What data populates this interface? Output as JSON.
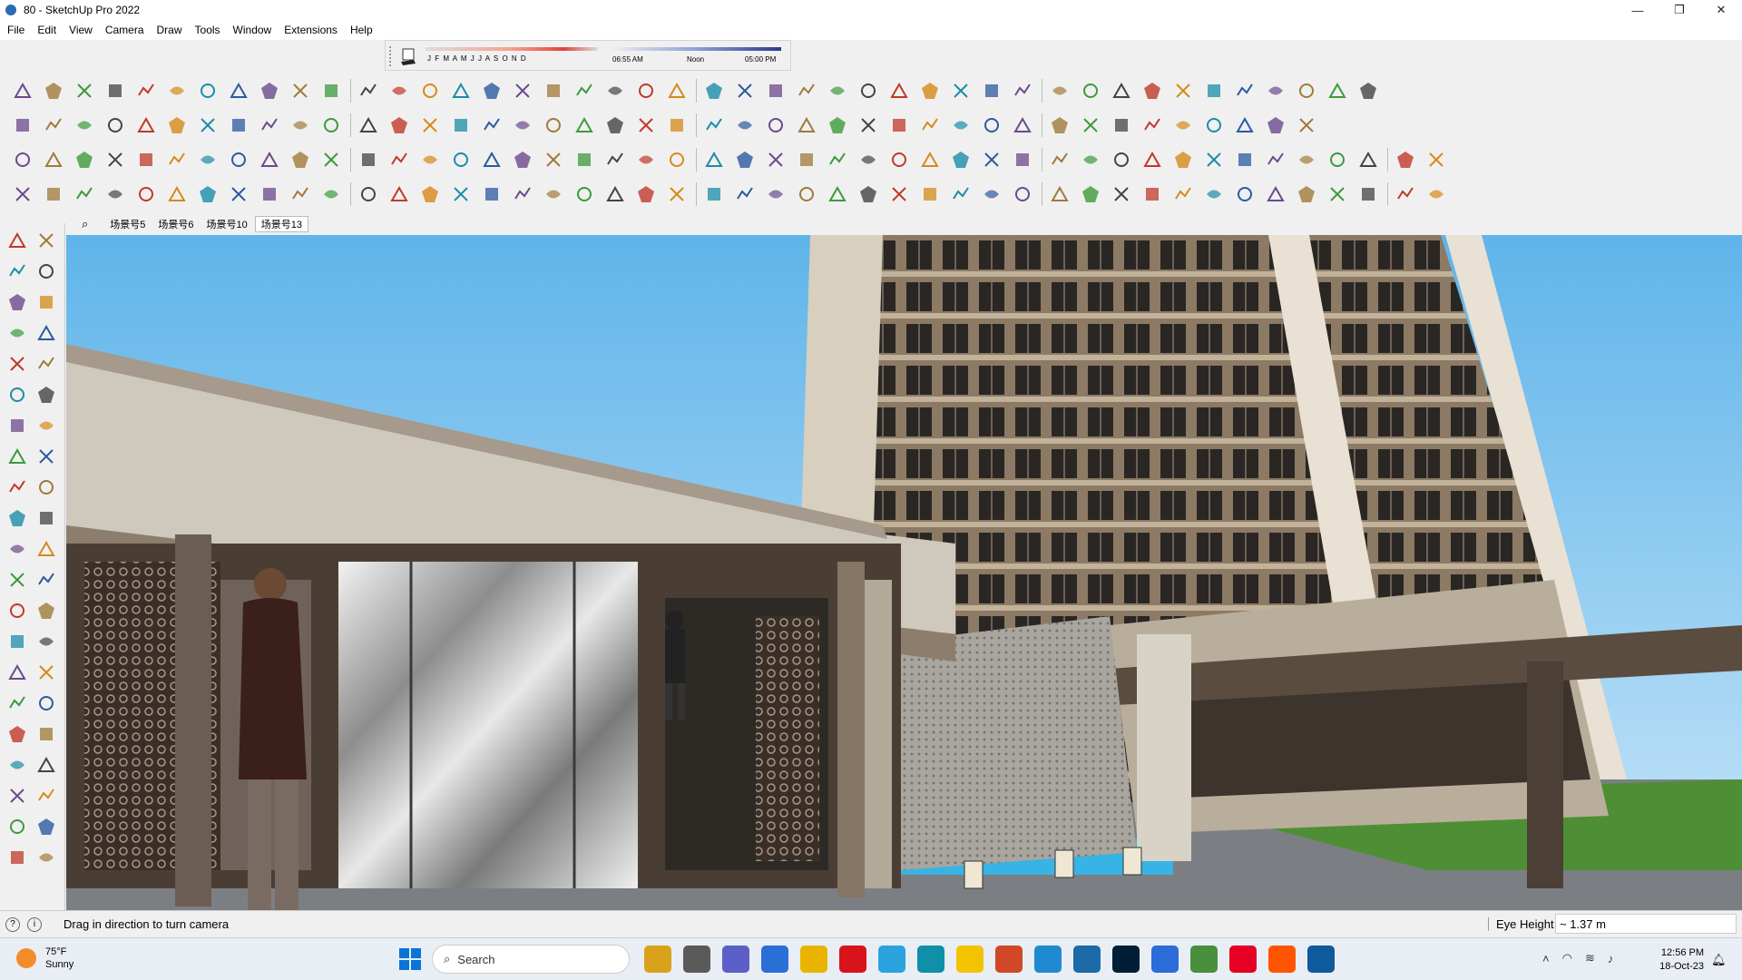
{
  "window": {
    "title": "80 - SketchUp Pro 2022",
    "minimize": "—",
    "maximize": "❐",
    "close": "✕"
  },
  "menu": [
    "File",
    "Edit",
    "View",
    "Camera",
    "Draw",
    "Tools",
    "Window",
    "Extensions",
    "Help"
  ],
  "shadows": {
    "months": "J F M A M J J A S O N D",
    "time_start": "06:55 AM",
    "time_mid": "Noon",
    "time_end": "05:00 PM"
  },
  "scenes": {
    "tabs": [
      "场景号5",
      "场景号6",
      "场景号10",
      "场景号13"
    ],
    "active_index": 3
  },
  "status": {
    "hint": "Drag in direction to turn camera",
    "vcb_label": "Eye Height",
    "vcb_value": "~ 1.37 m"
  },
  "taskbar": {
    "temperature": "75°F",
    "condition": "Sunny",
    "search_placeholder": "Search",
    "time": "12:56 PM",
    "date": "18-Oct-23",
    "apps": [
      {
        "name": "file-explorer-icon",
        "color": "#d9a21b"
      },
      {
        "name": "task-view-icon",
        "color": "#5a5a5a"
      },
      {
        "name": "teams-icon",
        "color": "#5b5fc7"
      },
      {
        "name": "calculator-icon",
        "color": "#2a6fd6"
      },
      {
        "name": "folder-icon",
        "color": "#e8b400"
      },
      {
        "name": "opera-icon",
        "color": "#d7141a"
      },
      {
        "name": "telegram-icon",
        "color": "#2aa3df"
      },
      {
        "name": "app-icon",
        "color": "#0f8fa8"
      },
      {
        "name": "sticky-notes-icon",
        "color": "#f3c300"
      },
      {
        "name": "grammarly-icon",
        "color": "#d24726"
      },
      {
        "name": "vscode-icon",
        "color": "#1f8ad2"
      },
      {
        "name": "sketchup-icon",
        "color": "#1c6aa8"
      },
      {
        "name": "photoshop-icon",
        "color": "#001e36"
      },
      {
        "name": "drive-icon",
        "color": "#2b6cd8"
      },
      {
        "name": "chrome-icon",
        "color": "#4a8f3e"
      },
      {
        "name": "pinterest-icon",
        "color": "#e60023"
      },
      {
        "name": "soundcloud-icon",
        "color": "#ff5500"
      },
      {
        "name": "sketchup-active-icon",
        "color": "#0e5a9c"
      }
    ]
  }
}
